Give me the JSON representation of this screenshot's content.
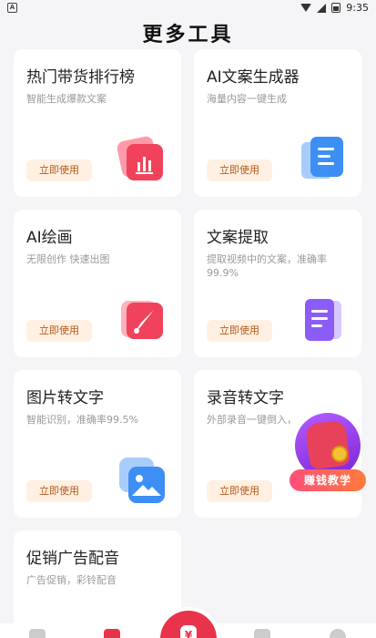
{
  "status_bar": {
    "notification_glyph": "A",
    "time": "9:35"
  },
  "title": "更多工具",
  "use_label": "立即使用",
  "cards": [
    {
      "title": "热门带货排行榜",
      "desc": "智能生成爆款文案",
      "icon": "bar-chart-icon",
      "color": "#f0435b"
    },
    {
      "title": "AI文案生成器",
      "desc": "海量内容一键生成",
      "icon": "document-lines-icon",
      "color": "#3d8ff5"
    },
    {
      "title": "AI绘画",
      "desc": "无限创作 快速出图",
      "icon": "paintbrush-icon",
      "color": "#f0435b"
    },
    {
      "title": "文案提取",
      "desc": "提取视频中的文案，准确率99.9%",
      "icon": "text-extract-icon",
      "color": "#8b5cf6"
    },
    {
      "title": "图片转文字",
      "desc": "智能识别，准确率99.5%",
      "icon": "image-icon",
      "color": "#3d8ff5"
    },
    {
      "title": "录音转文字",
      "desc": "外部录音一键倒入，",
      "icon": "audio-icon",
      "color": "#8b5cf6"
    },
    {
      "title": "促销广告配音",
      "desc": "广告促销，彩铃配音",
      "icon": "",
      "color": ""
    }
  ],
  "promo": {
    "label": "赚钱教学",
    "icon": "money-fist-icon"
  },
  "nav": {
    "center_glyph": "¥"
  }
}
